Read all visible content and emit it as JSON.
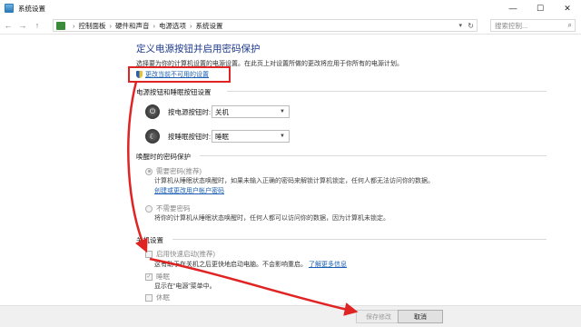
{
  "window": {
    "title": "系统设置",
    "controls": {
      "minimize": "—",
      "maximize": "☐",
      "close": "✕"
    }
  },
  "address": {
    "crumbs": [
      "控制面板",
      "硬件和声音",
      "电源选项",
      "系统设置"
    ],
    "search_placeholder": "搜索控制..."
  },
  "main": {
    "heading": "定义电源按钮并启用密码保护",
    "description": "选择要为你的计算机设置的电源设置。在此页上对设置所做的更改将应用于你所有的电源计划。",
    "change_link": "更改当前不可用的设置"
  },
  "power_section": {
    "title": "电源按钮和睡眠按钮设置",
    "rows": [
      {
        "label": "按电源按钮时:",
        "value": "关机"
      },
      {
        "label": "按睡眠按钮时:",
        "value": "睡眠"
      }
    ]
  },
  "password_section": {
    "title": "唤醒时的密码保护",
    "options": [
      {
        "label": "需要密码(推荐)",
        "selected": true,
        "text_lines": [
          "计算机从睡眠状态唤醒时，如果未输入正确的密码来解锁计算机锁定，任何人都无法访问你的数据。"
        ],
        "link": "创建或更改用户帐户密码"
      },
      {
        "label": "不需要密码",
        "selected": false,
        "text_lines": [
          "将你的计算机从睡眠状态唤醒时，任何人都可以访问你的数据，因为计算机未锁定。"
        ]
      }
    ]
  },
  "shutdown_section": {
    "title": "关机设置",
    "items": [
      {
        "label": "启用快速启动(推荐)",
        "checked": false,
        "desc": "这有助于在关机之后更快地启动电脑。不会影响重启。",
        "link": "了解更多信息"
      },
      {
        "label": "睡眠",
        "checked": true,
        "desc": "显示在“电源”菜单中。"
      },
      {
        "label": "休眠",
        "checked": false
      }
    ]
  },
  "footer": {
    "save_label": "保存修改",
    "cancel_label": "取消"
  },
  "annotation": {
    "color": "#e02323"
  }
}
